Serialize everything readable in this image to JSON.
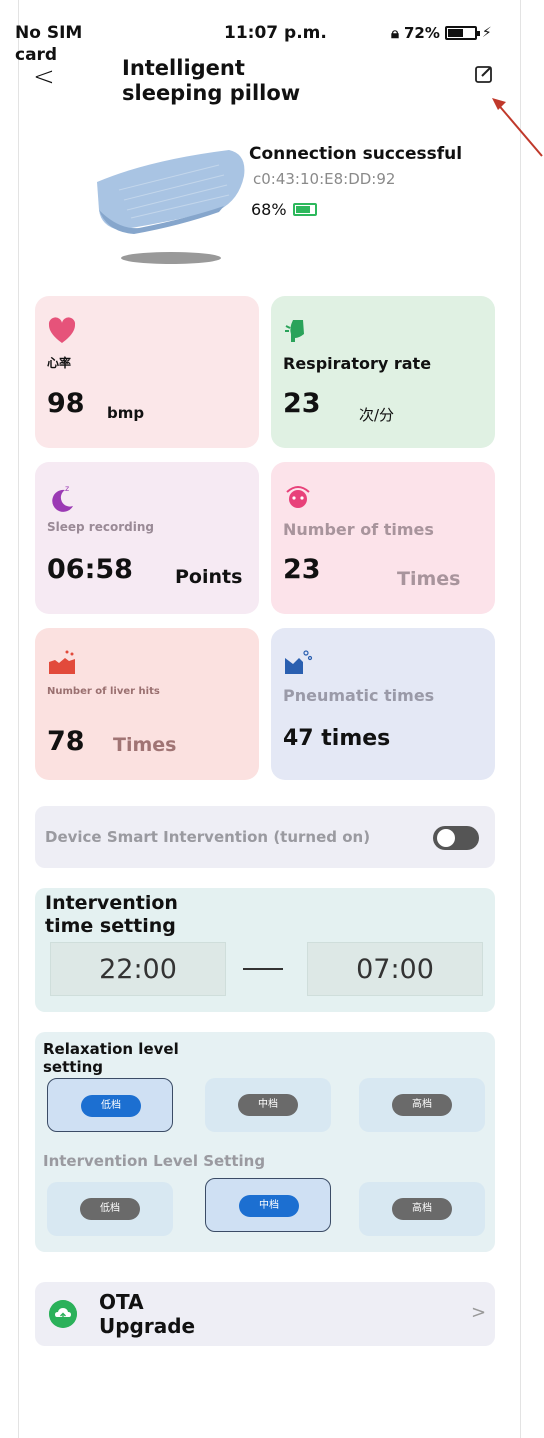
{
  "status_bar": {
    "carrier": "No SIM card",
    "time": "11:07 p.m.",
    "battery": "72%"
  },
  "header": {
    "title": "Intelligent sleeping pillow"
  },
  "device": {
    "connection": "Connection successful",
    "mac": "c0:43:10:E8:DD:92",
    "battery": "68%"
  },
  "cards": [
    {
      "label": "心率",
      "value": "98",
      "unit": "bmp"
    },
    {
      "label": "Respiratory rate",
      "value": "23",
      "unit": "次/分"
    },
    {
      "label": "Sleep recording",
      "value": "06:58",
      "unit": "Points"
    },
    {
      "label": "Number of times",
      "value": "23",
      "unit": "Times"
    },
    {
      "label": "Number of liver hits",
      "value": "78",
      "unit": "Times"
    },
    {
      "label": "Pneumatic times",
      "value": "47 times",
      "unit": ""
    }
  ],
  "smart_intervention": {
    "label": "Device Smart Intervention (turned on)"
  },
  "intervention_time": {
    "title": "Intervention time setting",
    "start": "22:00",
    "end": "07:00"
  },
  "relaxation": {
    "title": "Relaxation level setting",
    "options": [
      "低档",
      "中档",
      "高档"
    ],
    "selected": 0
  },
  "intervention_level": {
    "title": "Intervention Level Setting",
    "options": [
      "低档",
      "中档",
      "高档"
    ],
    "selected": 1
  },
  "ota": {
    "label": "OTA Upgrade"
  },
  "colors": {
    "accent_blue": "#1c6fd1",
    "ota_green": "#2bb15a",
    "toggle_gray": "#555555"
  }
}
